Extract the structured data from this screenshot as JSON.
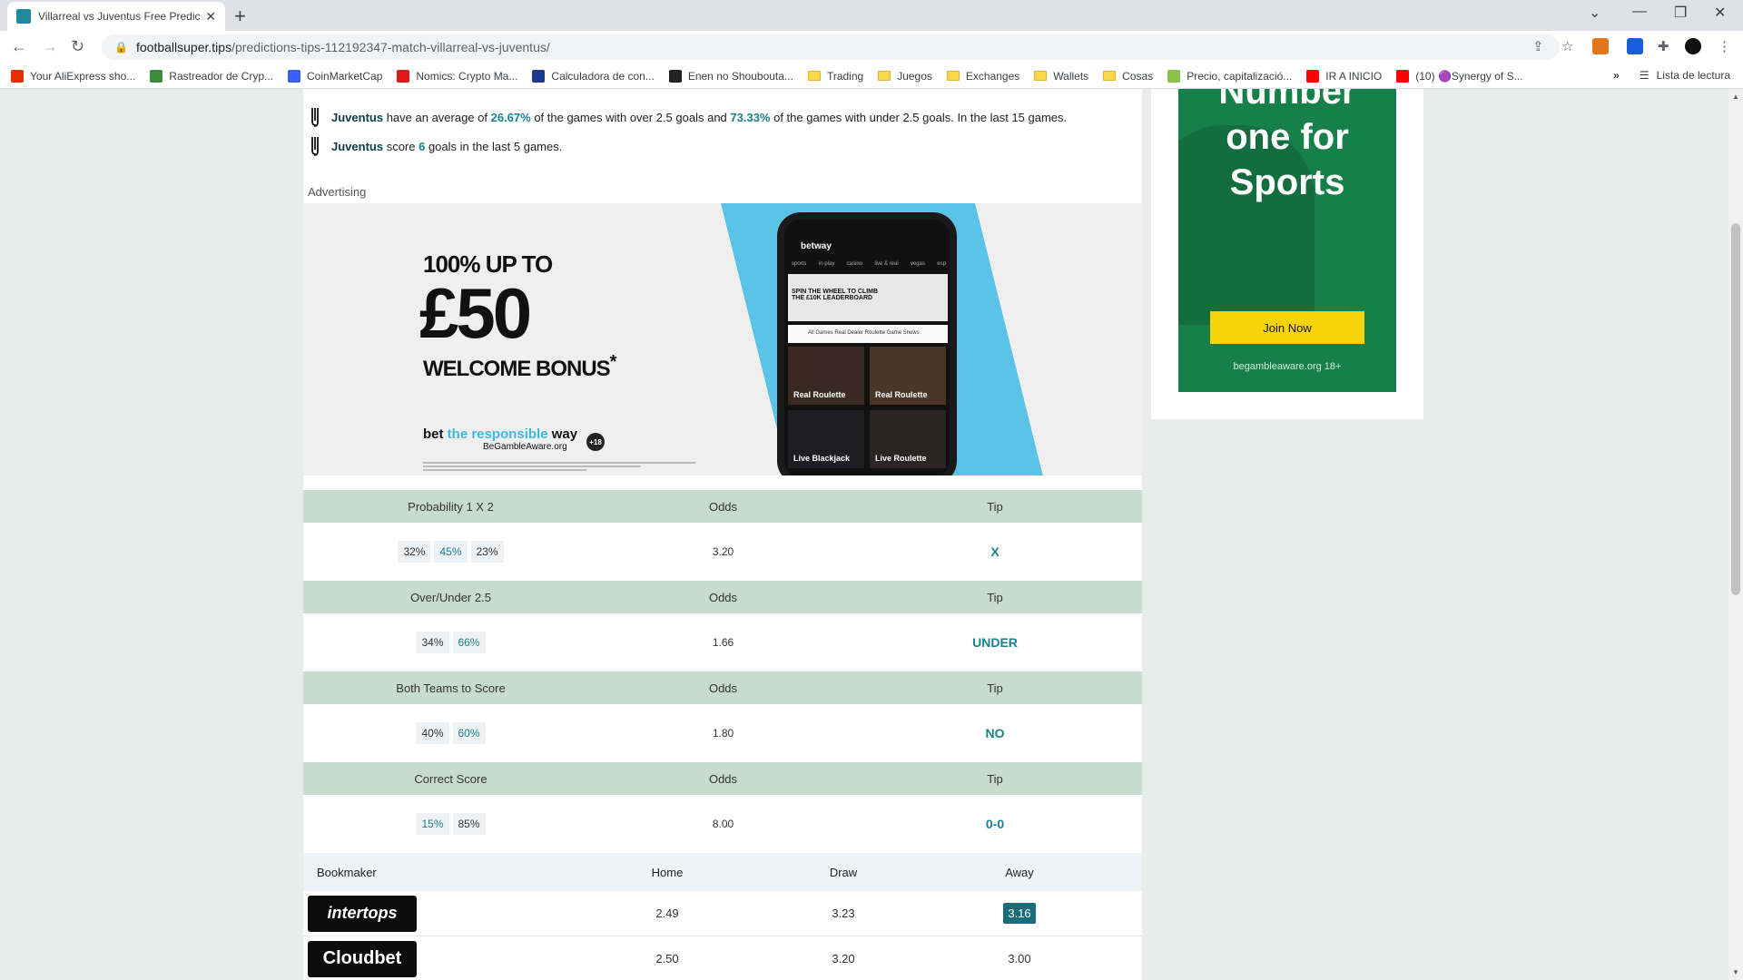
{
  "browser": {
    "tab_title": "Villarreal vs Juventus Free Predict",
    "url_host": "footballsuper.tips",
    "url_path": "/predictions-tips-112192347-match-villarreal-vs-juventus/",
    "bookmarks": [
      {
        "label": "Your AliExpress sho...",
        "color": "#e62e04",
        "kind": "icon"
      },
      {
        "label": "Rastreador de Cryp...",
        "color": "#3c8c3c",
        "kind": "icon"
      },
      {
        "label": "CoinMarketCap",
        "color": "#3861fb",
        "kind": "icon"
      },
      {
        "label": "Nomics: Crypto Ma...",
        "color": "#e01a1a",
        "kind": "icon"
      },
      {
        "label": "Calculadora de con...",
        "color": "#1b3a8c",
        "kind": "icon"
      },
      {
        "label": "Enen no Shouboutа...",
        "color": "#222222",
        "kind": "icon"
      },
      {
        "label": "Trading",
        "kind": "folder"
      },
      {
        "label": "Juegos",
        "kind": "folder"
      },
      {
        "label": "Exchanges",
        "kind": "folder"
      },
      {
        "label": "Wallets",
        "kind": "folder"
      },
      {
        "label": "Cosas",
        "kind": "folder"
      },
      {
        "label": "Precio, capitalizació...",
        "color": "#8bc34a",
        "kind": "icon"
      },
      {
        "label": "IR A INICIO",
        "color": "#ff0000",
        "kind": "icon"
      },
      {
        "label": "(10) 🟣Synergy of S...",
        "color": "#ff0000",
        "kind": "icon"
      }
    ],
    "reading_list": "Lista de lectura"
  },
  "stats": {
    "line1": {
      "team": "Juventus",
      "t1": " have an average of ",
      "v1": "26.67%",
      "t2": " of the games with over 2.5 goals and ",
      "v2": "73.33%",
      "t3": " of the games with under 2.5 goals. In the last 15 games."
    },
    "line2": {
      "team": "Juventus",
      "t1": " score ",
      "v1": "6",
      "t2": " goals in the last 5 games."
    }
  },
  "ad_label": "Advertising",
  "banner": {
    "line1": "100% UP TO",
    "line2": "£50",
    "line3": "WELCOME BONUS",
    "line3_mark": "*",
    "resp_pre": "bet ",
    "resp_mid": "the responsible ",
    "resp_post": "way",
    "aware": "BeGambleAware.org",
    "age": "+18",
    "phone_brand": "betway",
    "phone_menu": [
      "sports",
      "in-play",
      "casino",
      "live & real",
      "vegas",
      "esp"
    ],
    "phone_promo": "SPIN THE WHEEL TO CLIMB THE £10K LEADERBOARD",
    "phone_tabs": "All Games   Real Dealer   Roulette   Game Shows",
    "tiles": [
      "Real Roulette",
      "Real Roulette",
      "Live Blackjack",
      "Live Roulette"
    ]
  },
  "predictions": [
    {
      "header": "Probability 1 X 2",
      "odds_label": "Odds",
      "tip_label": "Tip",
      "pcts": [
        "32%",
        "45%",
        "23%"
      ],
      "hl_index": 1,
      "odds": "3.20",
      "tip": "X"
    },
    {
      "header": "Over/Under 2.5",
      "odds_label": "Odds",
      "tip_label": "Tip",
      "pcts": [
        "34%",
        "66%"
      ],
      "hl_index": 1,
      "odds": "1.66",
      "tip": "UNDER"
    },
    {
      "header": "Both Teams to Score",
      "odds_label": "Odds",
      "tip_label": "Tip",
      "pcts": [
        "40%",
        "60%"
      ],
      "hl_index": 1,
      "odds": "1.80",
      "tip": "NO"
    },
    {
      "header": "Correct Score",
      "odds_label": "Odds",
      "tip_label": "Tip",
      "pcts": [
        "15%",
        "85%"
      ],
      "hl_index": 0,
      "odds": "8.00",
      "tip": "0-0"
    }
  ],
  "bookmakers": {
    "headers": {
      "bookmaker": "Bookmaker",
      "home": "Home",
      "draw": "Draw",
      "away": "Away"
    },
    "rows": [
      {
        "name": "intertops",
        "home": "2.49",
        "draw": "3.23",
        "away": "3.16",
        "best": "away"
      },
      {
        "name": "Cloudbet",
        "home": "2.50",
        "draw": "3.20",
        "away": "3.00",
        "best": ""
      }
    ]
  },
  "sidebar_ad": {
    "headline_lines": [
      "Number",
      "one for",
      "Sports"
    ],
    "button": "Join Now",
    "aware": "begambleaware.org  18+"
  },
  "colors": {
    "accent": "#1a7f8e",
    "table_header": "#c8dcce",
    "ad_green": "#17804a",
    "ad_button": "#f7d40a"
  }
}
